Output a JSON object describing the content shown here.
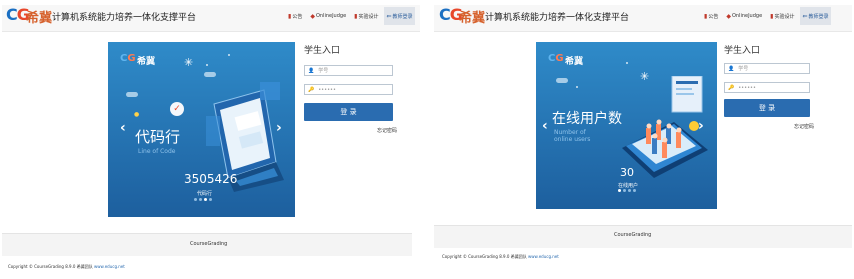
{
  "brand": {
    "logo_mark_c": "C",
    "logo_mark_g": "G",
    "logo_cn": "希冀",
    "platform_name": "计算机系统能力培养一体化支撑平台"
  },
  "nav": {
    "items": [
      {
        "label": "公告",
        "icon": "bell-icon"
      },
      {
        "label": "OnlineJudge",
        "icon": "code-icon"
      },
      {
        "label": "实验设计",
        "icon": "flask-icon"
      },
      {
        "label": "教师登录",
        "icon": "login-icon"
      }
    ]
  },
  "left_screen": {
    "banner": {
      "logo_cn": "希冀",
      "headline": "代码行",
      "subline": "Line of Code",
      "stat_value": "3505426",
      "stat_label": "代码行",
      "prev_arrow": "‹",
      "next_arrow": "›",
      "slide_count": 4,
      "active_slide": 3
    }
  },
  "right_screen": {
    "banner": {
      "logo_cn": "希冀",
      "headline": "在线用户数",
      "subline_1": "Number of",
      "subline_2": "online users",
      "stat_value": "30",
      "stat_label": "在线用户",
      "prev_arrow": "‹",
      "next_arrow": "›",
      "slide_count": 4,
      "active_slide": 1
    }
  },
  "login": {
    "title": "学生入口",
    "username_placeholder": "学号",
    "password_placeholder": "••••••",
    "username_icon": "user-icon",
    "password_icon": "key-icon",
    "submit_label": "登 录",
    "forgot_label": "忘记密码"
  },
  "footer": {
    "name": "CourseGrading",
    "copyright_prefix": "Copyright © CourseGrading 8.9.0 ",
    "copyright_org": "希冀团队",
    "copyright_link": "www.educg.net"
  },
  "colors": {
    "accent": "#2a6cb0",
    "banner_top": "#2f8bc9",
    "banner_bottom": "#1d5f9e",
    "brand_orange": "#d6612c"
  }
}
